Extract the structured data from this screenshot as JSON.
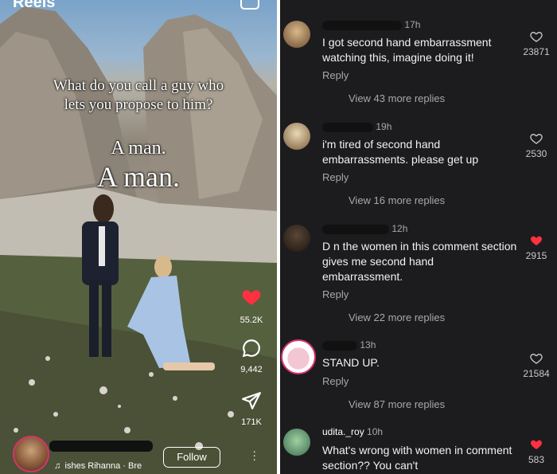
{
  "reel": {
    "header_title": "Reels",
    "caption_question": "What do you call a guy who lets you propose to him?",
    "caption_answer_small": "A man.",
    "caption_answer_large": "A man.",
    "likes_count": "55.2K",
    "comments_count": "9,442",
    "shares_count": "171K",
    "music_label": "♫  ishes   Rihanna · Bre",
    "follow_label": "Follow",
    "liked": true,
    "heart_color": "#ff3040"
  },
  "comments": [
    {
      "time": "17h",
      "text": "I got second hand embarrassment watching this, imagine doing it!",
      "reply_label": "Reply",
      "view_replies": "View 43 more replies",
      "likes": "23871",
      "liked": false
    },
    {
      "time": "19h",
      "text": "i'm tired of second hand embarrassments. please get up",
      "reply_label": "Reply",
      "view_replies": "View 16 more replies",
      "likes": "2530",
      "liked": false
    },
    {
      "time": "12h",
      "text": "D      n the women in this comment section gives me second hand embarrassment.",
      "reply_label": "Reply",
      "view_replies": "View 22 more replies",
      "likes": "2915",
      "liked": true
    },
    {
      "time": "13h",
      "text": "STAND UP.",
      "reply_label": "Reply",
      "view_replies": "View 87 more replies",
      "likes": "21584",
      "liked": false
    },
    {
      "username": "udita._roy",
      "time": "10h",
      "text": "What's wrong with women in comment section?? You can't",
      "likes": "583",
      "liked": true
    }
  ],
  "colors": {
    "comments_bg": "#1c1c1e",
    "like_red": "#ff3040",
    "meta_gray": "#a8a8a8"
  }
}
